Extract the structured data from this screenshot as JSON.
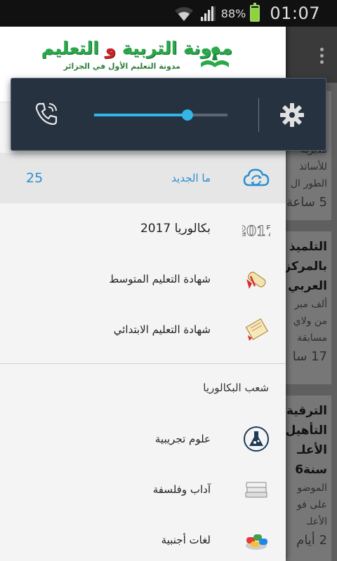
{
  "status_bar": {
    "battery_percent": "88%",
    "battery_level": 0.88,
    "time": "01:07"
  },
  "drawer": {
    "header": {
      "logo_title_part1": "مدونة التربية",
      "logo_title_conj": " و ",
      "logo_title_part2": "التعليم",
      "logo_subtitle": "مدونة التعليم الأول في الجزائر"
    },
    "items": [
      {
        "label": "ما الجديد",
        "count": "25",
        "icon": "cloud-sync-icon"
      },
      {
        "label": "بكالوريا 2017",
        "icon": "year-2017-icon"
      },
      {
        "label": "شهادة التعليم المتوسط",
        "icon": "diploma-scroll-icon"
      },
      {
        "label": "شهادة التعليم الابتدائي",
        "icon": "scroll-icon"
      }
    ],
    "section_header": "شعب البكالوريا",
    "branches": [
      {
        "label": "علوم تجريبية",
        "icon": "science-flask-icon"
      },
      {
        "label": "آداب وفلسفة",
        "icon": "books-icon"
      },
      {
        "label": "لغات أجنبية",
        "icon": "languages-icon"
      }
    ]
  },
  "volume_panel": {
    "level": 0.7,
    "colors": {
      "bg": "#263240",
      "accent": "#33b5e5"
    }
  },
  "background_cards": [
    {
      "title": "",
      "desc_lines": [
        "مديرية",
        "للأساتذ",
        "الطور ال"
      ],
      "time": "5 ساعة"
    },
    {
      "title_lines": [
        "التلميذ",
        "بالمركز",
        "العربي"
      ],
      "desc_lines": [
        "ألف مبر",
        "من ولاي",
        "مسابقة"
      ],
      "time": "17 سا"
    },
    {
      "title_lines": [
        "الترقية",
        "التأهيل",
        "الأعلـ",
        "سنة6"
      ],
      "desc_lines": [
        "الموضو",
        "على فو",
        "الأعلـ"
      ],
      "time": "2 أيام"
    }
  ]
}
